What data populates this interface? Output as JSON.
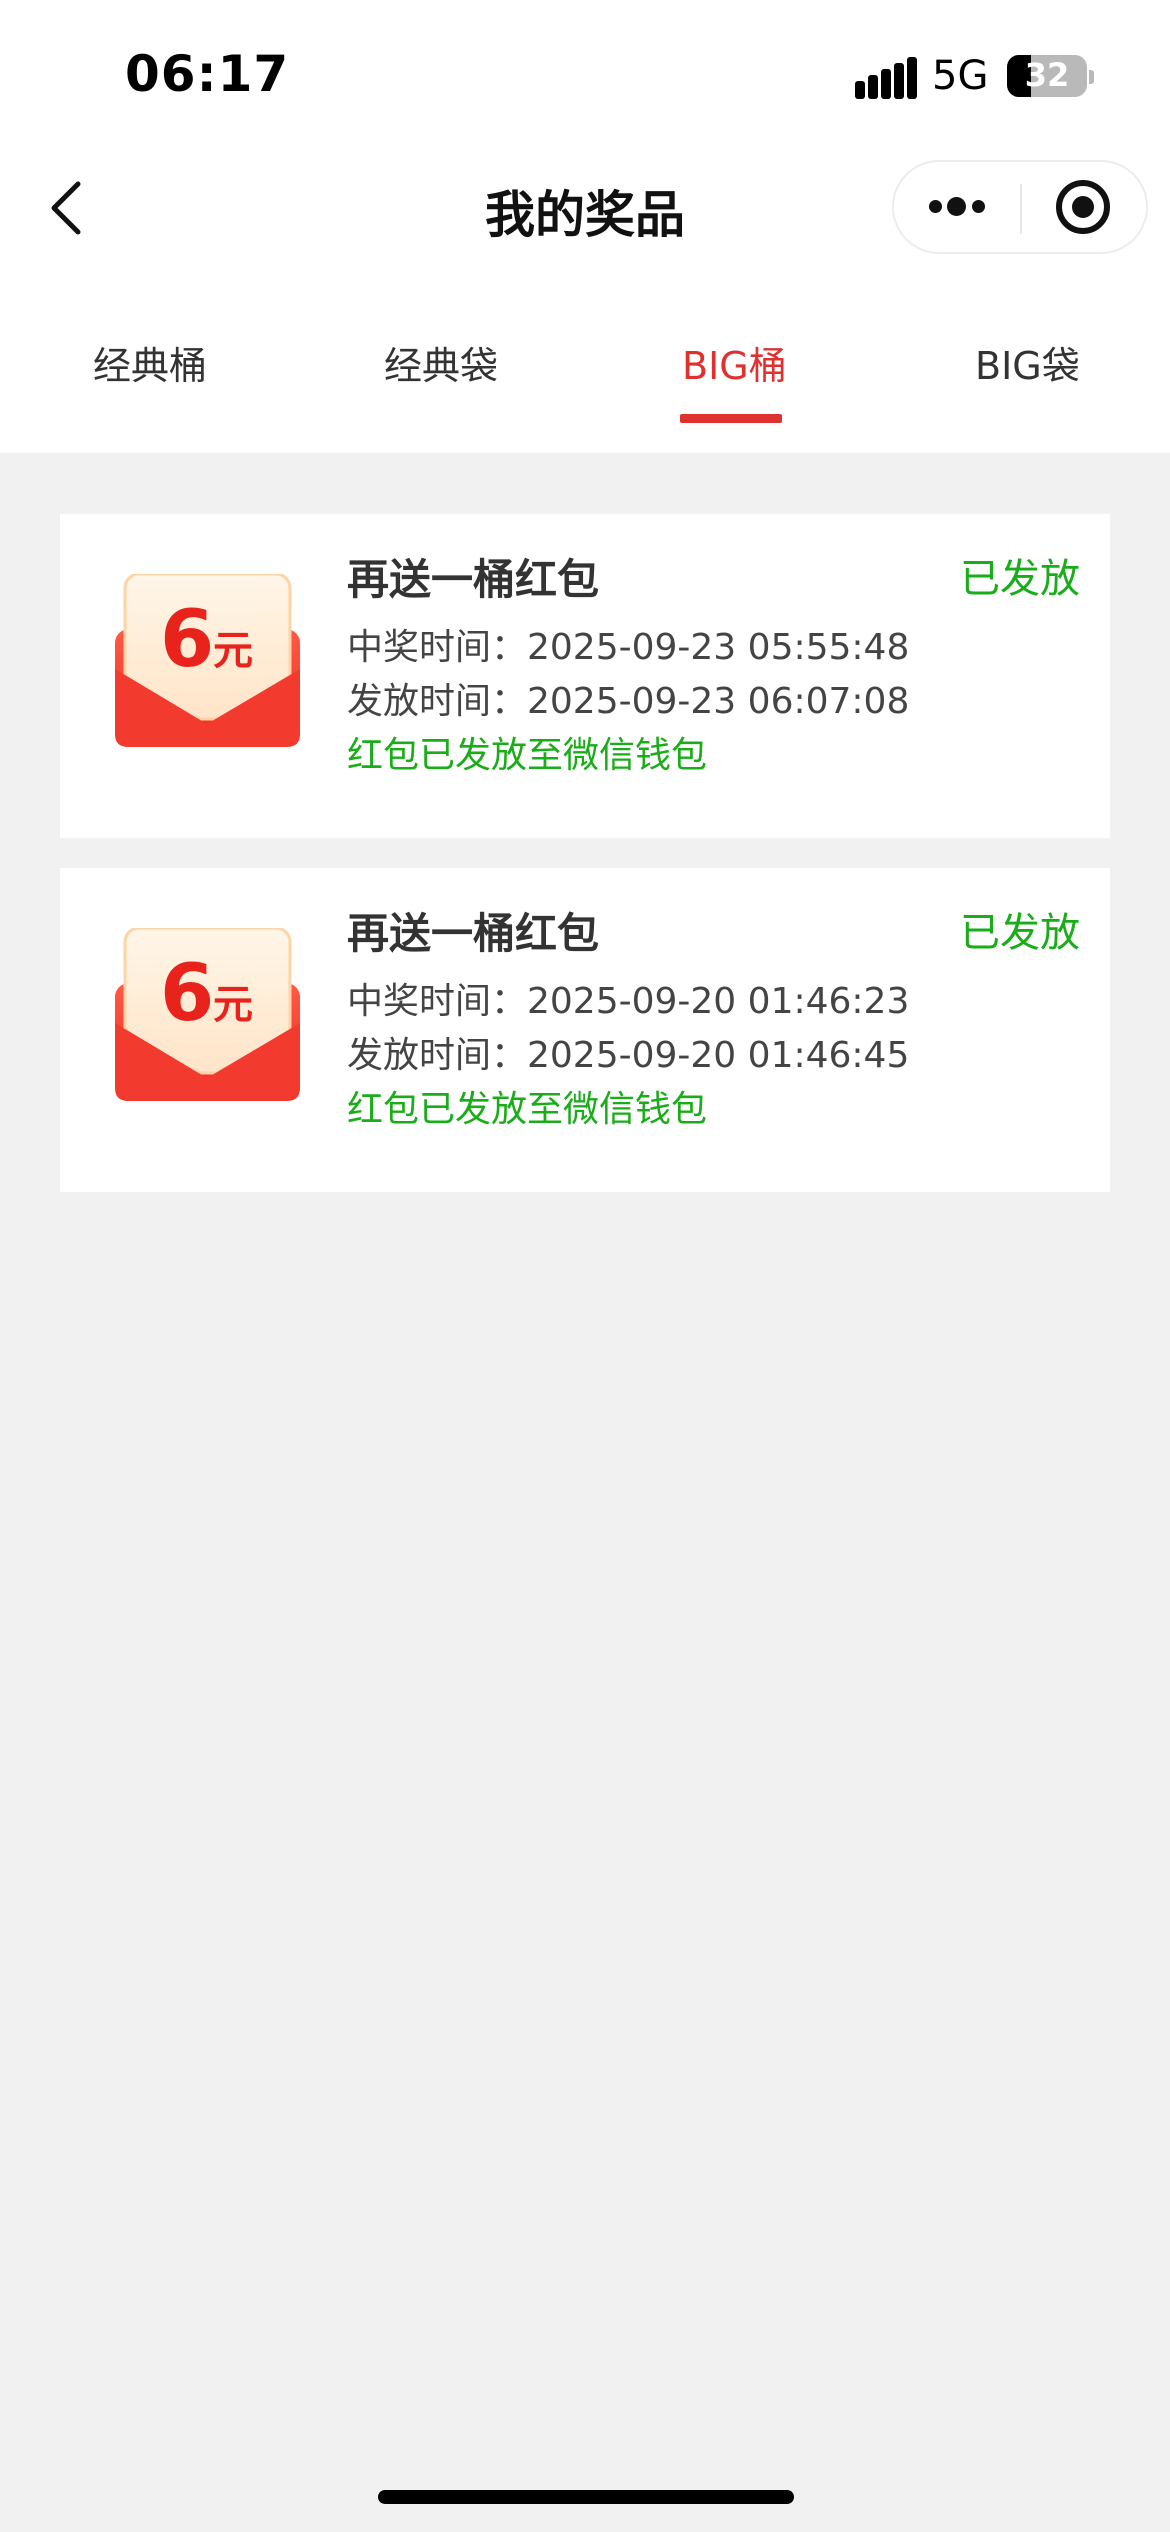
{
  "status_bar": {
    "time": "06:17",
    "network": "5G",
    "battery": "32"
  },
  "nav": {
    "title": "我的奖品",
    "back_icon": "chevron-left-icon",
    "more_icon": "more-dots-icon",
    "close_icon": "target-circle-icon"
  },
  "tabs": [
    {
      "label": "经典桶",
      "active": false
    },
    {
      "label": "经典袋",
      "active": false
    },
    {
      "label": "BIG桶",
      "active": true
    },
    {
      "label": "BIG袋",
      "active": false
    }
  ],
  "prizes": [
    {
      "amount": "6",
      "unit": "元",
      "title": "再送一桶红包",
      "status": "已发放",
      "win_time": "中奖时间：2025-09-23 05:55:48",
      "issue_time": "发放时间：2025-09-23 06:07:08",
      "note": "红包已发放至微信钱包"
    },
    {
      "amount": "6",
      "unit": "元",
      "title": "再送一桶红包",
      "status": "已发放",
      "win_time": "中奖时间：2025-09-20 01:46:23",
      "issue_time": "发放时间：2025-09-20 01:46:45",
      "note": "红包已发放至微信钱包"
    }
  ],
  "colors": {
    "accent_red": "#e03131",
    "success_green": "#1aad19",
    "background": "#f1f1f1"
  }
}
